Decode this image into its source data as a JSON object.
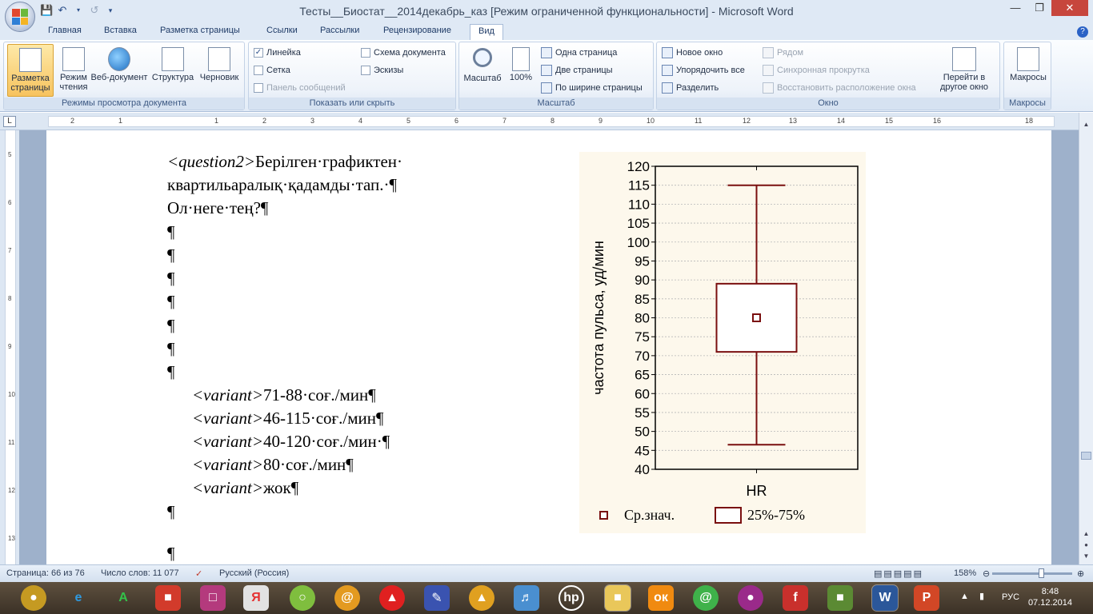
{
  "window": {
    "title": "Тесты__Биостат__2014декабрь_каз [Режим ограниченной функциональности] - Microsoft Word"
  },
  "tabs": [
    "Главная",
    "Вставка",
    "Разметка страницы",
    "Ссылки",
    "Рассылки",
    "Рецензирование",
    "Вид"
  ],
  "ribbon": {
    "views": {
      "label": "Режимы просмотра документа",
      "buttons": [
        "Разметка страницы",
        "Режим чтения",
        "Веб-документ",
        "Структура",
        "Черновик"
      ]
    },
    "show": {
      "label": "Показать или скрыть",
      "ruler": "Линейка",
      "grid": "Сетка",
      "messages": "Панель сообщений",
      "docmap": "Схема документа",
      "thumbs": "Эскизы"
    },
    "zoom": {
      "label": "Масштаб",
      "zoom_btn": "Масштаб",
      "zoom100": "100%",
      "one_page": "Одна страница",
      "two_pages": "Две страницы",
      "page_width": "По ширине страницы"
    },
    "window_group": {
      "label": "Окно",
      "new_window": "Новое окно",
      "arrange_all": "Упорядочить все",
      "split": "Разделить",
      "side_by_side": "Рядом",
      "sync_scroll": "Синхронная прокрутка",
      "reset_pos": "Восстановить расположение окна",
      "switch": "Перейти в другое окно"
    },
    "macros": {
      "label": "Макросы",
      "button": "Макросы"
    }
  },
  "ruler": {
    "numbers": [
      "2",
      "1",
      "1",
      "2",
      "3",
      "4",
      "5",
      "6",
      "7",
      "8",
      "9",
      "10",
      "11",
      "12",
      "13",
      "14",
      "15",
      "16",
      "18"
    ],
    "vnumbers": [
      "5",
      "6",
      "7",
      "8",
      "9",
      "10",
      "11",
      "12",
      "13"
    ]
  },
  "document": {
    "q_tag": "<question2>",
    "q_line1": "Берілген·графиктен·",
    "q_line2": "квартильаралық·қадамды·тап.·¶",
    "q_line3": "Ол·неге·тең?¶",
    "pilcrow": "¶",
    "variant_tag": "<variant>",
    "variants": [
      "71-88·соғ./мин¶",
      "46-115·соғ./мин¶",
      "40-120·соғ./мин·¶",
      "80·соғ./мин¶",
      "жок¶"
    ]
  },
  "chart_data": {
    "type": "box",
    "category": "HR",
    "ylabel": "частота пульса, уд/мин",
    "ylim": [
      40,
      120
    ],
    "yticks": [
      40,
      45,
      50,
      55,
      60,
      65,
      70,
      75,
      80,
      85,
      90,
      95,
      100,
      105,
      110,
      115,
      120
    ],
    "yticklabels": [
      "40",
      "45",
      "50",
      "55",
      "60",
      "65",
      "70",
      "75",
      "80",
      "85",
      "90",
      "95",
      "100",
      "105",
      "110",
      "115",
      "120"
    ],
    "mean": 80,
    "q1": 71,
    "q3": 89,
    "whisker_low": 46.5,
    "whisker_high": 115,
    "legend": [
      "Ср.знач.",
      "25%-75%"
    ],
    "grid": true,
    "colors": {
      "box": "#7a0f0f",
      "background": "#fdf8ec",
      "grid": "#b8b8b8"
    }
  },
  "status": {
    "page": "Страница: 66 из 76",
    "words": "Число слов: 11 077",
    "language": "Русский (Россия)",
    "zoom": "158%"
  },
  "taskbar": {
    "lang": "РУС",
    "time": "8:48",
    "date": "07.12.2014"
  }
}
